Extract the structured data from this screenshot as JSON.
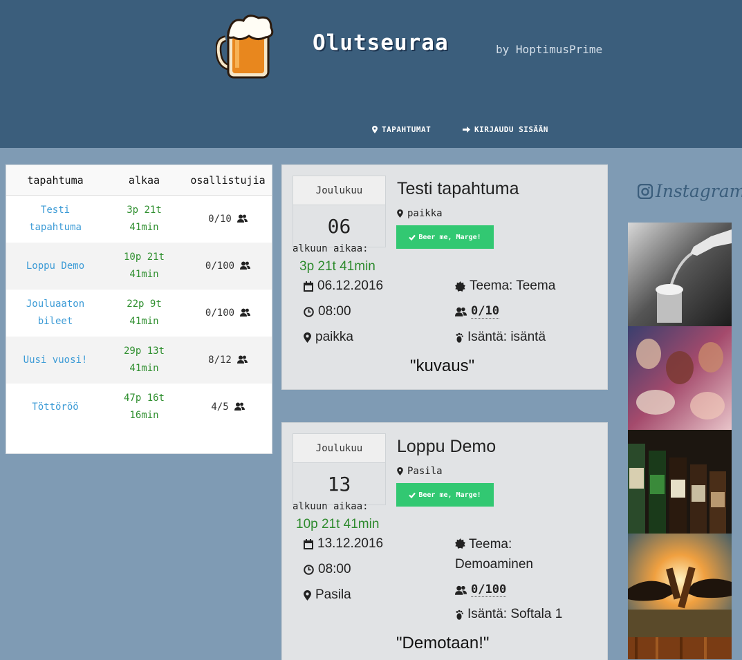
{
  "header": {
    "title": "Olutseuraa",
    "by": "by HoptimusPrime",
    "nav": [
      {
        "label": "TAPAHTUMAT",
        "icon": "map-marker-icon"
      },
      {
        "label": "KIRJAUDU SISÄÄN",
        "icon": "arrow-right-icon"
      }
    ]
  },
  "table": {
    "headers": [
      "tapahtuma",
      "alkaa",
      "osallistujia"
    ],
    "rows": [
      {
        "name_l1": "Testi",
        "name_l2": "tapahtuma",
        "start_l1": "3p 21t",
        "start_l2": "41min",
        "count": "0/10"
      },
      {
        "name_l1": "Loppu Demo",
        "name_l2": "",
        "start_l1": "10p 21t",
        "start_l2": "41min",
        "count": "0/100"
      },
      {
        "name_l1": "Jouluaaton",
        "name_l2": "bileet",
        "start_l1": "22p 9t",
        "start_l2": "41min",
        "count": "0/100"
      },
      {
        "name_l1": "Uusi vuosi!",
        "name_l2": "",
        "start_l1": "29p 13t",
        "start_l2": "41min",
        "count": "8/12"
      },
      {
        "name_l1": "Töttöröö",
        "name_l2": "",
        "start_l1": "47p 16t",
        "start_l2": "16min",
        "count": "4/5"
      }
    ]
  },
  "events": [
    {
      "month": "Joulukuu",
      "day": "06",
      "countdown_label": "alkuun aikaa:",
      "countdown": "3p 21t 41min",
      "title": "Testi tapahtuma",
      "place_small": "paikka",
      "button": "Beer me, Marge!",
      "date": "06.12.2016",
      "time": "08:00",
      "place": "paikka",
      "theme": "Teema: Teema",
      "participants": "0/10",
      "host": "Isäntä: isäntä",
      "description": "\"kuvaus\""
    },
    {
      "month": "Joulukuu",
      "day": "13",
      "countdown_label": "alkuun aikaa:",
      "countdown": "10p 21t 41min",
      "title": "Loppu Demo",
      "place_small": "Pasila",
      "button": "Beer me, Marge!",
      "date": "13.12.2016",
      "time": "08:00",
      "place": "Pasila",
      "theme_l1": "Teema:",
      "theme_l2": "Demoaminen",
      "participants": "0/100",
      "host": "Isäntä: Softala 1",
      "description": "\"Demotaan!\""
    }
  ],
  "instagram": {
    "title": "Instagram"
  },
  "colors": {
    "header_bg": "#3b5e7c",
    "page_bg": "#7f9bb4",
    "card_bg": "#e1e3e5",
    "button_green": "#32c872",
    "countdown_green": "#2d8a2d",
    "link_blue": "#3c9bd6"
  }
}
